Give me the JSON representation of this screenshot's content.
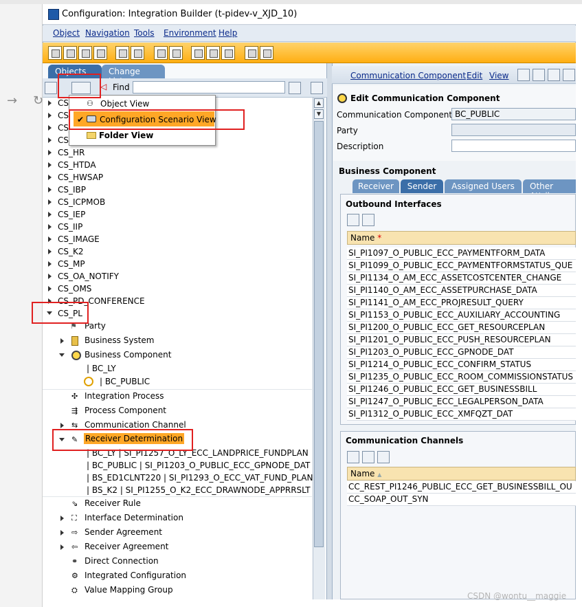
{
  "window": {
    "title": "Configuration: Integration Builder (t-pidev-v_XJD_10)"
  },
  "menu": [
    "Object",
    "Navigation",
    "Tools",
    "Environment",
    "Help"
  ],
  "left": {
    "tabs": [
      "Objects",
      "Change Lists"
    ],
    "find_label": "Find",
    "find_value": "",
    "dropdown": {
      "items": [
        {
          "label": "Object View",
          "selected": false
        },
        {
          "label": "Configuration Scenario View",
          "selected": true
        },
        {
          "label": "Folder View",
          "selected": false
        }
      ],
      "check": "✔"
    },
    "tree_top": [
      "CS_",
      "CS_",
      "CS_",
      "CS_"
    ],
    "tree_cs": [
      "CS_HR",
      "CS_HTDA",
      "CS_HWSAP",
      "CS_IBP",
      "CS_ICPMOB",
      "CS_IEP",
      "CS_IIP",
      "CS_IMAGE",
      "CS_K2",
      "CS_MP",
      "CS_OA_NOTIFY",
      "CS_OMS",
      "CS_PD_CONFERENCE",
      "CS_PL"
    ],
    "tree_children": {
      "party": "Party",
      "business_system": "Business System",
      "business_component": "Business Component",
      "bc_children": [
        "| BC_LY",
        "| BC_PUBLIC"
      ],
      "integration_process": "Integration Process",
      "process_component": "Process Component",
      "communication_channel": "Communication Channel",
      "receiver_determination": "Receiver Determination",
      "rd_children": [
        "| BC_LY | SI_PI1257_O_LY_ECC_LANDPRICE_FUNDPLAN",
        "| BC_PUBLIC | SI_PI1203_O_PUBLIC_ECC_GPNODE_DAT",
        "| BS_ED1CLNT220 | SI_PI1293_O_ECC_VAT_FUND_PLAN",
        "| BS_K2 | SI_PI1255_O_K2_ECC_DRAWNODE_APPRRSLT"
      ],
      "receiver_rule": "Receiver Rule",
      "interface_determination": "Interface Determination",
      "sender_agreement": "Sender Agreement",
      "receiver_agreement": "Receiver Agreement",
      "direct_connection": "Direct Connection",
      "integrated_configuration": "Integrated Configuration",
      "value_mapping_group": "Value Mapping Group"
    }
  },
  "right": {
    "links": [
      "Communication Component",
      "Edit",
      "View"
    ],
    "edit_title": "Edit Communication Component",
    "fields": {
      "comm_component_label": "Communication Component",
      "comm_component_value": "BC_PUBLIC",
      "party_label": "Party",
      "party_value": "",
      "description_label": "Description",
      "description_value": ""
    },
    "business_component_heading": "Business Component",
    "tabs": [
      "Receiver",
      "Sender",
      "Assigned Users",
      "Other Attribu"
    ],
    "outbound": {
      "title": "Outbound Interfaces",
      "column": "Name",
      "required_mark": "*",
      "rows": [
        "SI_PI1097_O_PUBLIC_ECC_PAYMENTFORM_DATA",
        "SI_PI1099_O_PUBLIC_ECC_PAYMENTFORMSTATUS_QUE",
        "SI_PI1134_O_AM_ECC_ASSETCOSTCENTER_CHANGE",
        "SI_PI1140_O_AM_ECC_ASSETPURCHASE_DATA",
        "SI_PI1141_O_AM_ECC_PROJRESULT_QUERY",
        "SI_PI1153_O_PUBLIC_ECC_AUXILIARY_ACCOUNTING",
        "SI_PI1200_O_PUBLIC_ECC_GET_RESOURCEPLAN",
        "SI_PI1201_O_PUBLIC_ECC_PUSH_RESOURCEPLAN",
        "SI_PI1203_O_PUBLIC_ECC_GPNODE_DAT",
        "SI_PI1214_O_PUBLIC_ECC_CONFIRM_STATUS",
        "SI_PI1235_O_PUBLIC_ECC_ROOM_COMMISSIONSTATUS",
        "SI_PI1246_O_PUBLIC_ECC_GET_BUSINESSBILL",
        "SI_PI1247_O_PUBLIC_ECC_LEGALPERSON_DATA",
        "SI_PI1312_O_PUBLIC_ECC_XMFQZT_DAT"
      ]
    },
    "channels": {
      "title": "Communication Channels",
      "column": "Name",
      "sort_mark": "▲",
      "rows": [
        "CC_REST_PI1246_PUBLIC_ECC_GET_BUSINESSBILL_OU",
        "CC_SOAP_OUT_SYN"
      ]
    }
  },
  "watermark": "CSDN @wontu__maggie",
  "colors": {
    "accent_orange": "#ffa726",
    "highlight_red": "#e02020",
    "tab_blue": "#3b6ea8"
  }
}
